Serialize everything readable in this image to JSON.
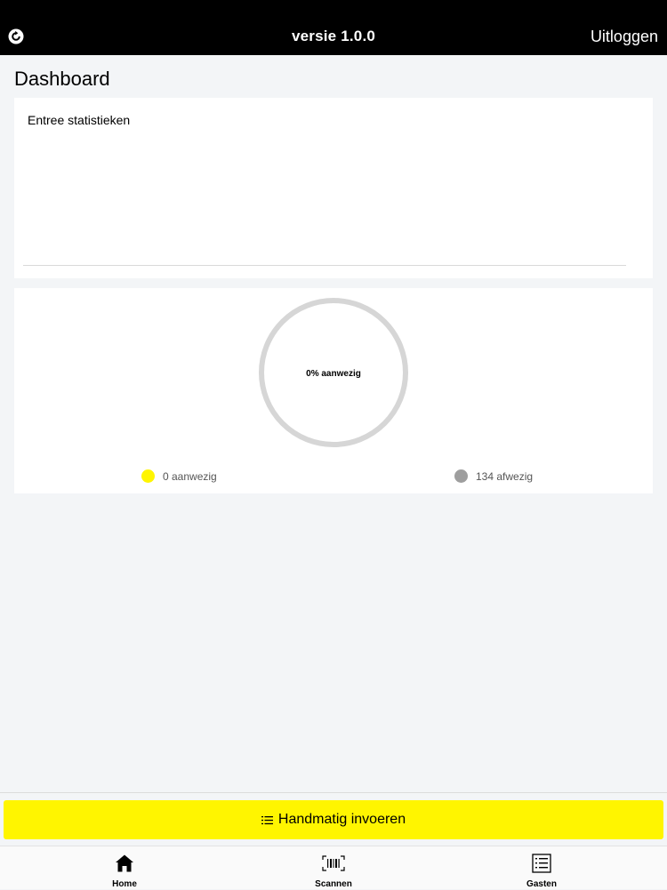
{
  "header": {
    "title": "versie 1.0.0",
    "logout_label": "Uitloggen",
    "logo_icon": "refresh-logo-icon"
  },
  "page": {
    "title": "Dashboard"
  },
  "stats_card": {
    "title": "Entree statistieken"
  },
  "attendance": {
    "center_label": "0% aanwezig",
    "present_fraction": 0,
    "legend": [
      {
        "label": "0 aanwezig",
        "color": "#fff500"
      },
      {
        "label": "134 afwezig",
        "color": "#9e9e9e"
      }
    ]
  },
  "actions": {
    "manual_entry_label": "Handmatig invoeren",
    "manual_entry_icon": "list-icon"
  },
  "tabbar": {
    "items": [
      {
        "label": "Home",
        "icon": "home-icon"
      },
      {
        "label": "Scannen",
        "icon": "barcode-icon"
      },
      {
        "label": "Gasten",
        "icon": "list-icon"
      }
    ]
  },
  "colors": {
    "accent": "#fff500",
    "header_bg": "#000000",
    "absent": "#9e9e9e",
    "donut_track": "#d6d6d6"
  }
}
